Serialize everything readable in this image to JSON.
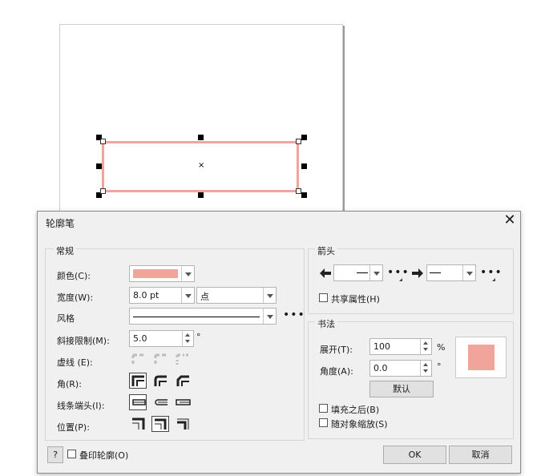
{
  "canvas": {
    "center_mark": "×",
    "outline_color": "#f1a49a"
  },
  "dialog": {
    "title": "轮廓笔",
    "close_glyph": "✕",
    "general": {
      "title": "常规",
      "color_label": "颜色",
      "color_key": "(C):",
      "color_value": "#f1a49a",
      "width_label": "宽度",
      "width_key": "(W):",
      "width_value": "8.0 pt",
      "width_unit": "点",
      "style_label": "风格",
      "miter_label": "斜接限制",
      "miter_key": "(M):",
      "miter_value": "5.0",
      "miter_unit": "°",
      "dash_label": "虚线 (E):",
      "corner_label": "角",
      "corner_key": "(R):",
      "cap_label": "线条端头",
      "cap_key": "(I):",
      "position_label": "位置",
      "position_key": "(P):"
    },
    "arrows": {
      "title": "箭头",
      "share_label": "共享属性",
      "share_key": "(H)"
    },
    "calligraphy": {
      "title": "书法",
      "stretch_label": "展开",
      "stretch_key": "(T):",
      "stretch_value": "100",
      "stretch_unit": "%",
      "angle_label": "角度",
      "angle_key": "(A):",
      "angle_value": "0.0",
      "angle_unit": "°",
      "default_button": "默认",
      "preview_color": "#f1a49a"
    },
    "after_fill_label": "填充之后",
    "after_fill_key": "(B)",
    "scale_label": "随对象缩放",
    "scale_key": "(S)",
    "help_button": "?",
    "overprint_label": "叠印轮廓",
    "overprint_key": "(O)",
    "ok_button": "OK",
    "cancel_button": "取消"
  }
}
